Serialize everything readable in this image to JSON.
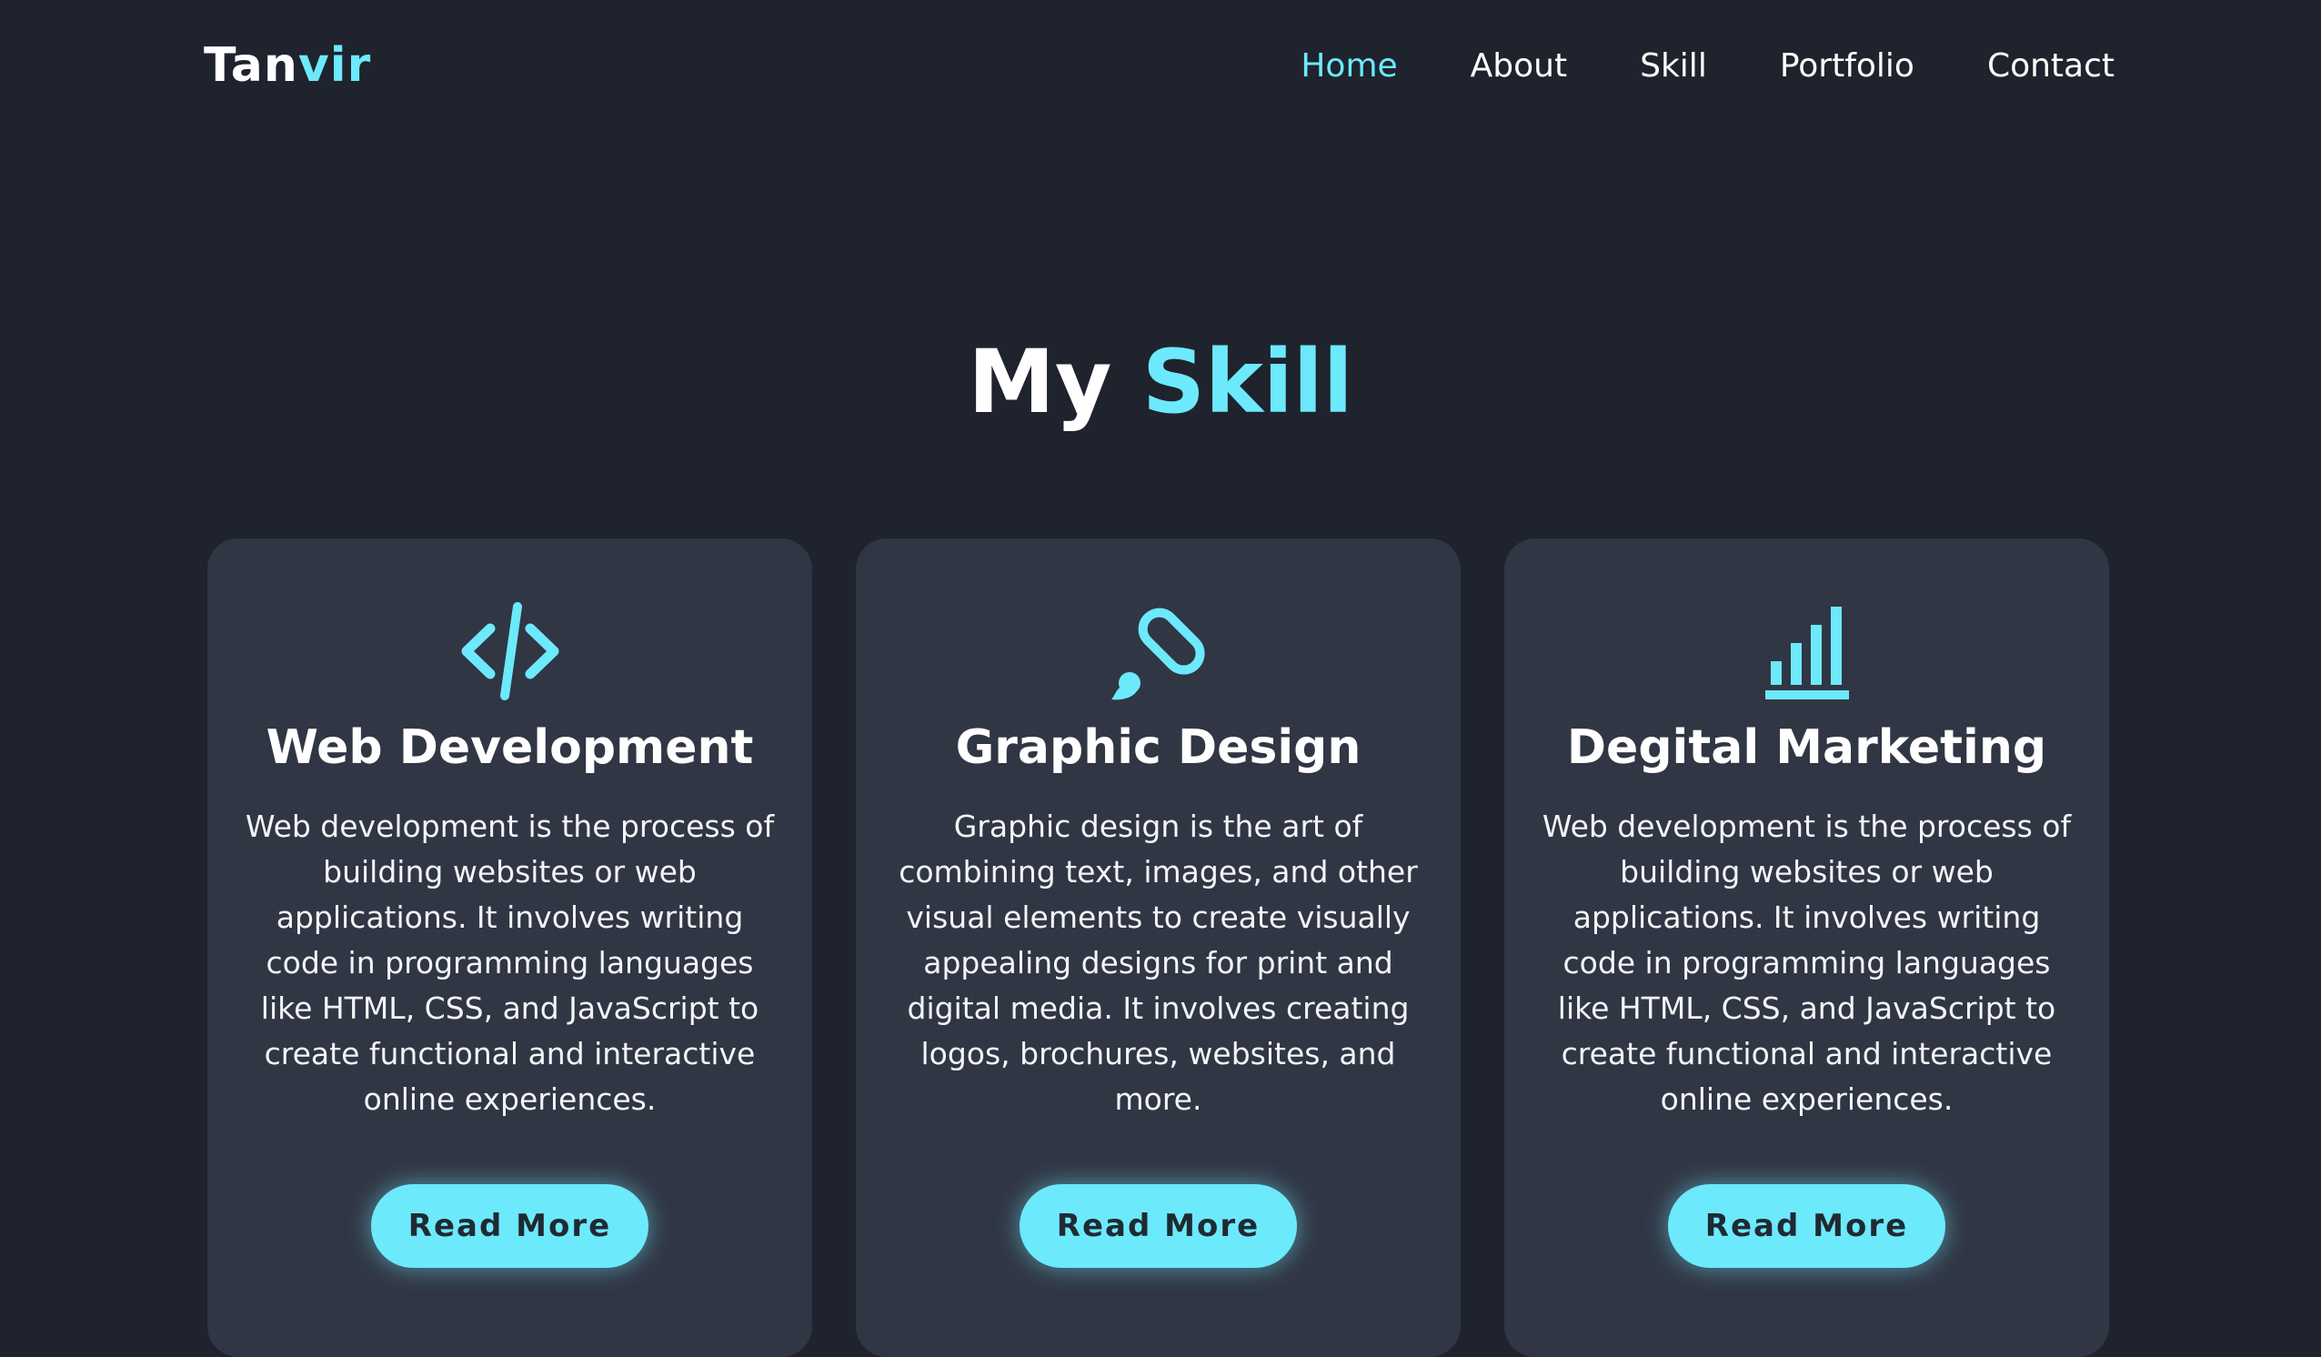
{
  "logo": {
    "part1": "Tan",
    "part2": "vir"
  },
  "nav": {
    "items": [
      {
        "label": "Home"
      },
      {
        "label": "About"
      },
      {
        "label": "Skill"
      },
      {
        "label": "Portfolio"
      },
      {
        "label": "Contact"
      }
    ],
    "active": "Home"
  },
  "section": {
    "title_part1": "My",
    "title_part2": "Skill"
  },
  "cards": [
    {
      "icon": "code-icon",
      "title": "Web Development",
      "text": "Web development is the process of building websites or web applications. It involves writing code in programming languages like HTML, CSS, and JavaScript to create functional and interactive online experiences.",
      "button": "Read More"
    },
    {
      "icon": "paintbrush-icon",
      "title": "Graphic Design",
      "text": "Graphic design is the art of combining text, images, and other visual elements to create visually appealing designs for print and digital media. It involves creating logos, brochures, websites, and more.",
      "button": "Read More"
    },
    {
      "icon": "bar-chart-icon",
      "title": "Degital Marketing",
      "text": "Web development is the process of building websites or web applications. It involves writing code in programming languages like HTML, CSS, and JavaScript to create functional and interactive online experiences.",
      "button": "Read More"
    }
  ],
  "colors": {
    "background": "#1f232d",
    "card": "#313644",
    "accent": "#6de9fc",
    "button_text": "#1f2a33"
  }
}
